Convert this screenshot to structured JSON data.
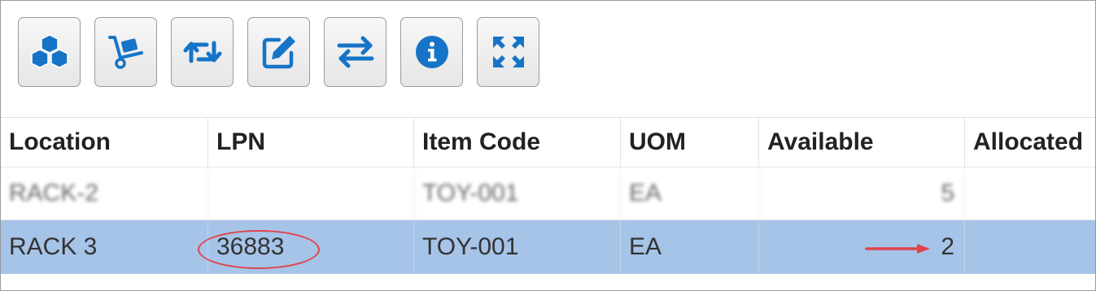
{
  "toolbar": {
    "buttons": [
      {
        "icon": "boxes-icon"
      },
      {
        "icon": "hand-truck-icon"
      },
      {
        "icon": "swap-cycle-icon"
      },
      {
        "icon": "edit-icon"
      },
      {
        "icon": "transfer-arrows-icon"
      },
      {
        "icon": "info-icon"
      },
      {
        "icon": "expand-icon"
      }
    ],
    "icon_color": "#1674c7"
  },
  "grid": {
    "columns": [
      "Location",
      "LPN",
      "Item Code",
      "UOM",
      "Available",
      "Allocated"
    ],
    "rows": [
      {
        "location": "RACK-2",
        "lpn": "",
        "item_code": "TOY-001",
        "uom": "EA",
        "available": "5",
        "allocated": "",
        "blurred": true
      },
      {
        "location": "RACK 3",
        "lpn": "36883",
        "item_code": "TOY-001",
        "uom": "EA",
        "available": "2",
        "allocated": "",
        "selected": true
      }
    ],
    "selected_row_color": "#a6c3e8"
  },
  "annotations": {
    "circle_color": "#e0434a",
    "arrow_color": "#e0434a"
  }
}
